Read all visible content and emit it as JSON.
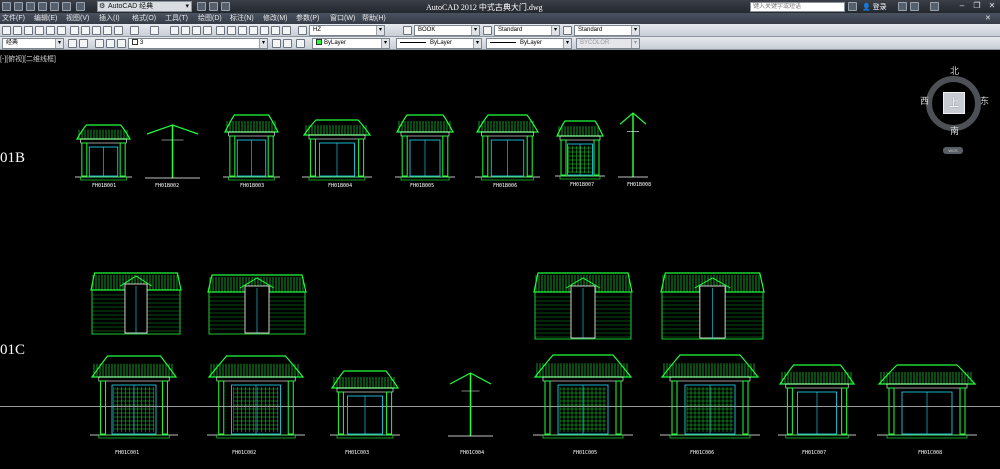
{
  "title_bar": {
    "workspace": "AutoCAD 经典",
    "app_title": "AutoCAD 2012    中式古典大门.dwg",
    "search_placeholder": "键入关键字或短语",
    "login_label": "登录"
  },
  "menu": {
    "items": [
      "文件(F)",
      "编辑(E)",
      "视图(V)",
      "插入(I)",
      "格式(O)",
      "工具(T)",
      "绘图(D)",
      "标注(N)",
      "修改(M)",
      "参数(P)",
      "窗口(W)",
      "帮助(H)"
    ]
  },
  "toolbar1": {
    "text_style": "HZ",
    "dim_style": "BOOK",
    "table_style": "Standard",
    "multileader_style": "Standard"
  },
  "toolbar2": {
    "workspace": "经典",
    "layer": "3",
    "color": "ByLayer",
    "linetype": "ByLayer",
    "lineweight": "ByLayer",
    "plotstyle": "BYCOLOR"
  },
  "canvas": {
    "viewport_label": "[-][俯视][二维线框]",
    "rows": [
      {
        "label": "01B",
        "drawings": [
          "FH01B001",
          "FH01B002",
          "FH01B003",
          "FH01B004",
          "FH01B005",
          "FH01B006",
          "FH01B007",
          "FH01B008"
        ]
      },
      {
        "label": "01C",
        "drawings": [
          "FH01C001",
          "FH01C002",
          "FH01C003",
          "FH01C004",
          "FH01C005",
          "FH01C006",
          "FH01C007",
          "FH01C008"
        ]
      }
    ]
  },
  "viewcube": {
    "north": "北",
    "south": "南",
    "east": "东",
    "west": "西",
    "face": "上",
    "wcs": "WCS"
  },
  "colors": {
    "drawing_green": "#1fff3a",
    "drawing_cyan": "#20e0ff",
    "drawing_white": "#ffffff",
    "canvas_bg": "#000000"
  }
}
